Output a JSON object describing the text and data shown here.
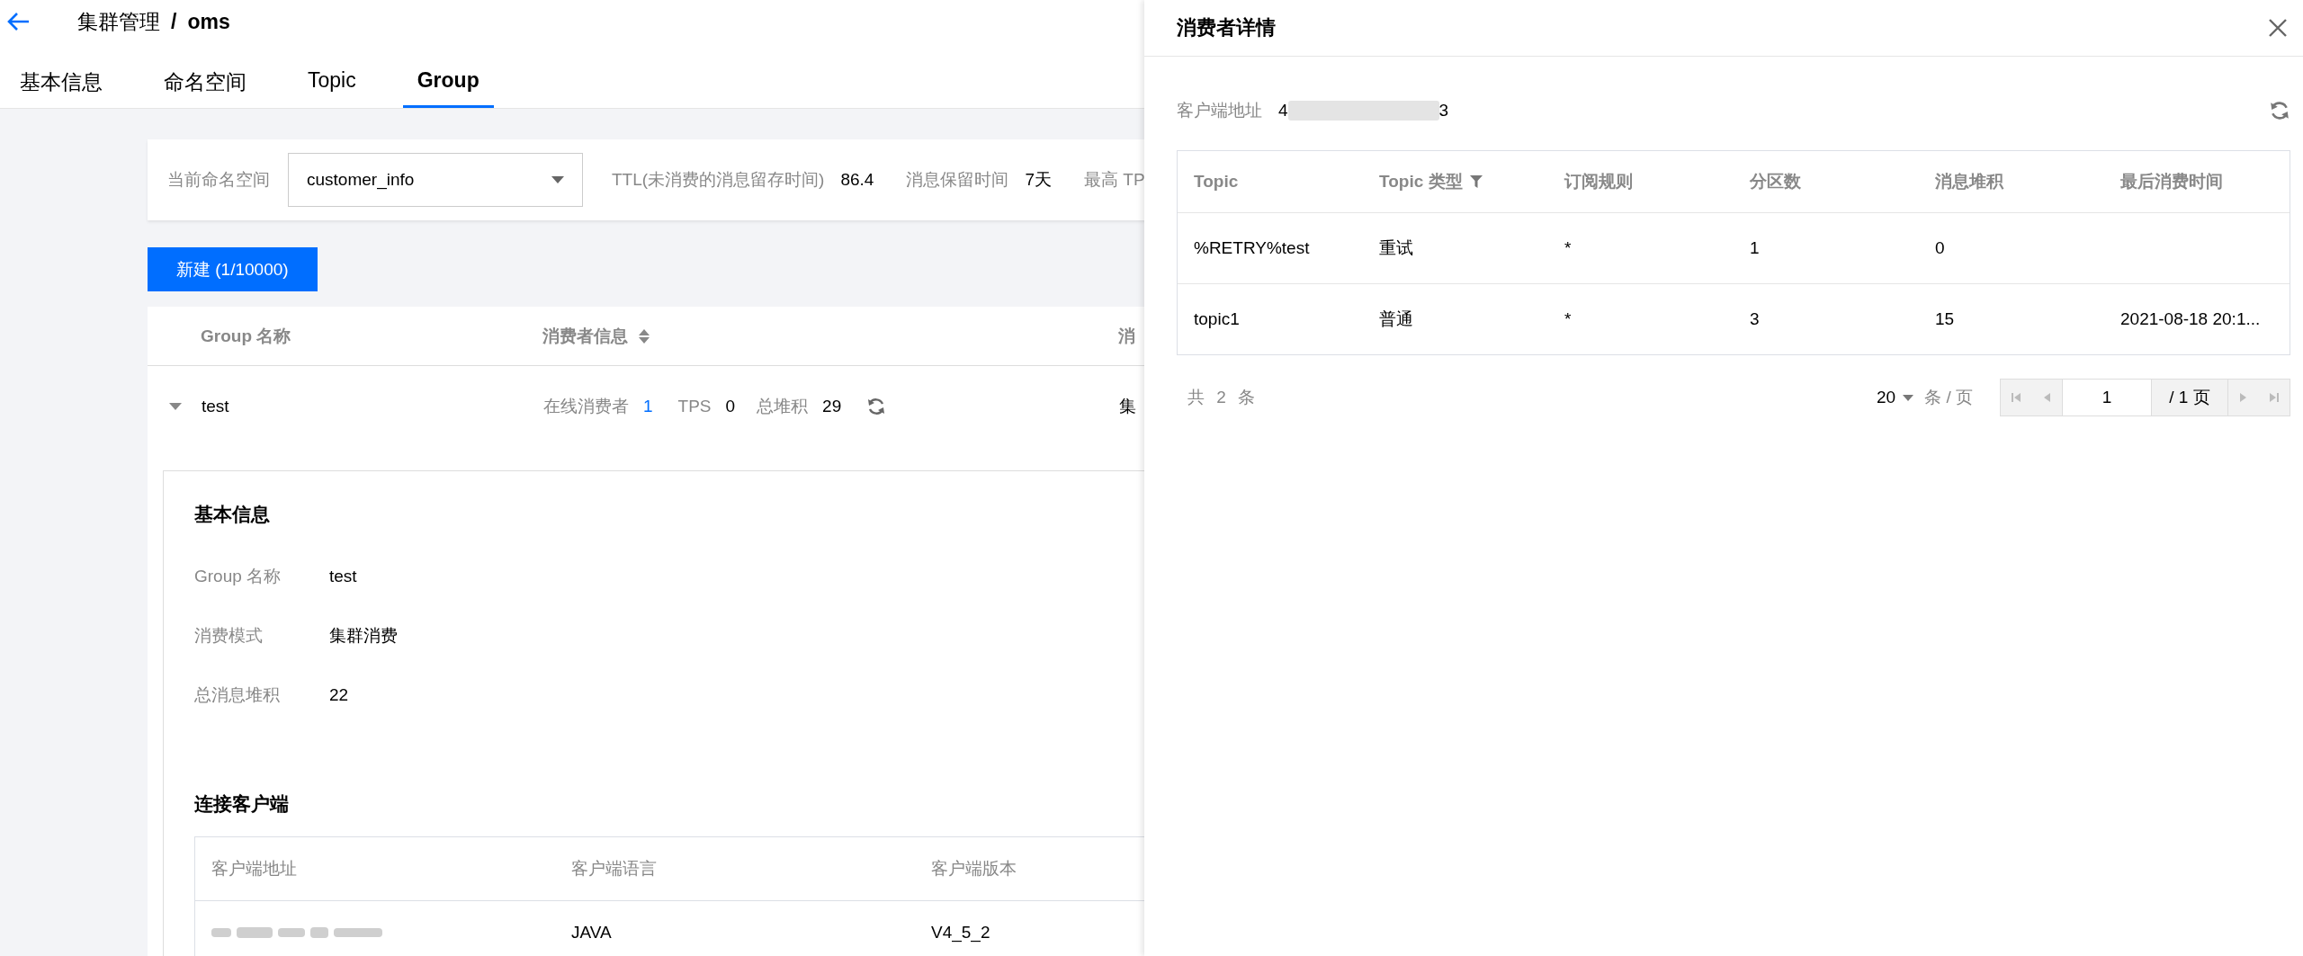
{
  "breadcrumb": {
    "parent": "集群管理",
    "separator": "/",
    "current": "oms"
  },
  "tabs": [
    {
      "label": "基本信息",
      "selected": false
    },
    {
      "label": "命名空间",
      "selected": false
    },
    {
      "label": "Topic",
      "selected": false
    },
    {
      "label": "Group",
      "selected": true
    }
  ],
  "namespace_bar": {
    "label": "当前命名空间",
    "value": "customer_info",
    "stats": [
      {
        "label": "TTL(未消费的消息留存时间)",
        "value": "86.4"
      },
      {
        "label": "消息保留时间",
        "value": "7天"
      },
      {
        "label": "最高 TP"
      }
    ]
  },
  "create_button": "新建 (1/10000)",
  "group_table": {
    "columns": [
      {
        "label": "Group 名称",
        "sortable": false
      },
      {
        "label": "消费者信息",
        "sortable": true
      },
      {
        "label": "消",
        "sortable": false
      }
    ],
    "rows": [
      {
        "expanded": true,
        "name": "test",
        "online_label": "在线消费者",
        "online": "1",
        "tps_label": "TPS",
        "tps": "0",
        "backlog_label": "总堆积",
        "backlog": "29",
        "column_3": "集"
      }
    ]
  },
  "detail": {
    "basic_title": "基本信息",
    "fields": [
      {
        "label": "Group 名称",
        "value": "test"
      },
      {
        "label": "消费模式",
        "value": "集群消费"
      },
      {
        "label": "总消息堆积",
        "value": "22"
      }
    ],
    "clients_title": "连接客户端",
    "client_columns": [
      "客户端地址",
      "客户端语言",
      "客户端版本"
    ],
    "client_rows": [
      {
        "language": "JAVA",
        "version": "V4_5_2"
      }
    ]
  },
  "drawer": {
    "title": "消费者详情",
    "address_label": "客户端地址",
    "address_start": "4",
    "address_end": "3",
    "columns": [
      {
        "label": "Topic",
        "filter": false
      },
      {
        "label": "Topic 类型",
        "filter": true
      },
      {
        "label": "订阅规则",
        "filter": false
      },
      {
        "label": "分区数",
        "filter": false
      },
      {
        "label": "消息堆积",
        "filter": false
      },
      {
        "label": "最后消费时间",
        "filter": false
      }
    ],
    "rows": [
      [
        "%RETRY%test",
        "重试",
        "*",
        "1",
        "0",
        ""
      ],
      [
        "topic1",
        "普通",
        "*",
        "3",
        "15",
        "2021-08-18 20:1..."
      ]
    ],
    "total": "共 2 条",
    "page_size": "20",
    "page_size_unit": "条 / 页",
    "page": "1",
    "page_total": "/ 1 页"
  }
}
